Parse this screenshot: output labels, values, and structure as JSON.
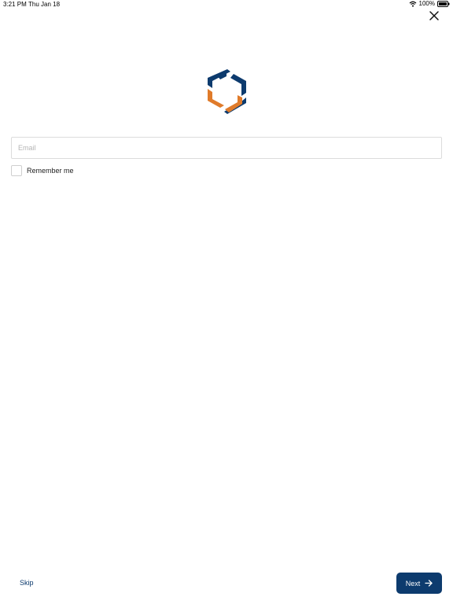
{
  "status_bar": {
    "time": "3:21 PM",
    "date": "Thu Jan 18",
    "battery": "100%"
  },
  "icons": {
    "close": "close-icon",
    "wifi": "wifi-icon",
    "battery": "battery-icon",
    "logo": "hexagon-logo-icon",
    "arrow": "arrow-right-icon"
  },
  "colors": {
    "brand_blue": "#0d3b6e",
    "brand_orange": "#e07b2a"
  },
  "form": {
    "email_placeholder": "Email",
    "email_value": "",
    "remember_label": "Remember me",
    "remember_checked": false
  },
  "footer": {
    "skip_label": "Skip",
    "next_label": "Next"
  }
}
